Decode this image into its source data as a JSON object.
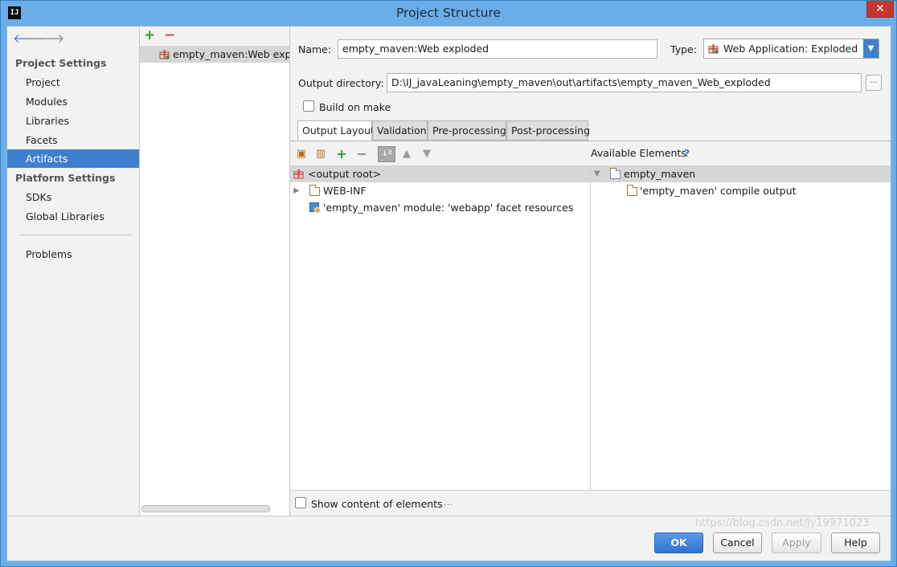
{
  "window": {
    "title": "Project Structure",
    "app_icon_text": "IJ",
    "close_glyph": "✕"
  },
  "nav": {
    "back_glyph": "🡐",
    "forward_glyph": "🡒",
    "project_settings_header": "Project Settings",
    "project_settings_items": [
      "Project",
      "Modules",
      "Libraries",
      "Facets",
      "Artifacts"
    ],
    "platform_settings_header": "Platform Settings",
    "platform_settings_items": [
      "SDKs",
      "Global Libraries"
    ],
    "problems": "Problems",
    "selected": "Artifacts"
  },
  "artifacts": {
    "add_glyph": "+",
    "remove_glyph": "−",
    "items": [
      "empty_maven:Web exploded"
    ]
  },
  "form": {
    "name_label": "Name:",
    "name_value": "empty_maven:Web exploded",
    "type_label": "Type:",
    "type_value": "Web Application: Exploded",
    "output_dir_label": "Output directory:",
    "output_dir_value": "D:\\IJ_javaLeaning\\empty_maven\\out\\artifacts\\empty_maven_Web_exploded",
    "browse_glyph": "...",
    "build_on_make": "Build on make",
    "build_on_make_checked": false
  },
  "tabs": [
    "Output Layout",
    "Validation",
    "Pre-processing",
    "Post-processing"
  ],
  "active_tab": "Output Layout",
  "layout_tree": {
    "root": "<output root>",
    "children": [
      "WEB-INF",
      "'empty_maven' module: 'webapp' facet resources"
    ]
  },
  "available": {
    "header": "Available Elements",
    "help_glyph": "?",
    "module": "empty_maven",
    "children": [
      "'empty_maven' compile output"
    ]
  },
  "show_content": {
    "label": "Show content of elements",
    "checked": false,
    "ellipsis_glyph": "…"
  },
  "buttons": {
    "ok": "OK",
    "cancel": "Cancel",
    "apply": "Apply",
    "help": "Help"
  },
  "watermark": "https://blog.csdn.net/jy19971023",
  "colors": {
    "accent": "#3e7fce",
    "title_bar": "#6aaee9",
    "close": "#c7372f",
    "add": "#2e9a3a",
    "remove": "#d64040"
  }
}
